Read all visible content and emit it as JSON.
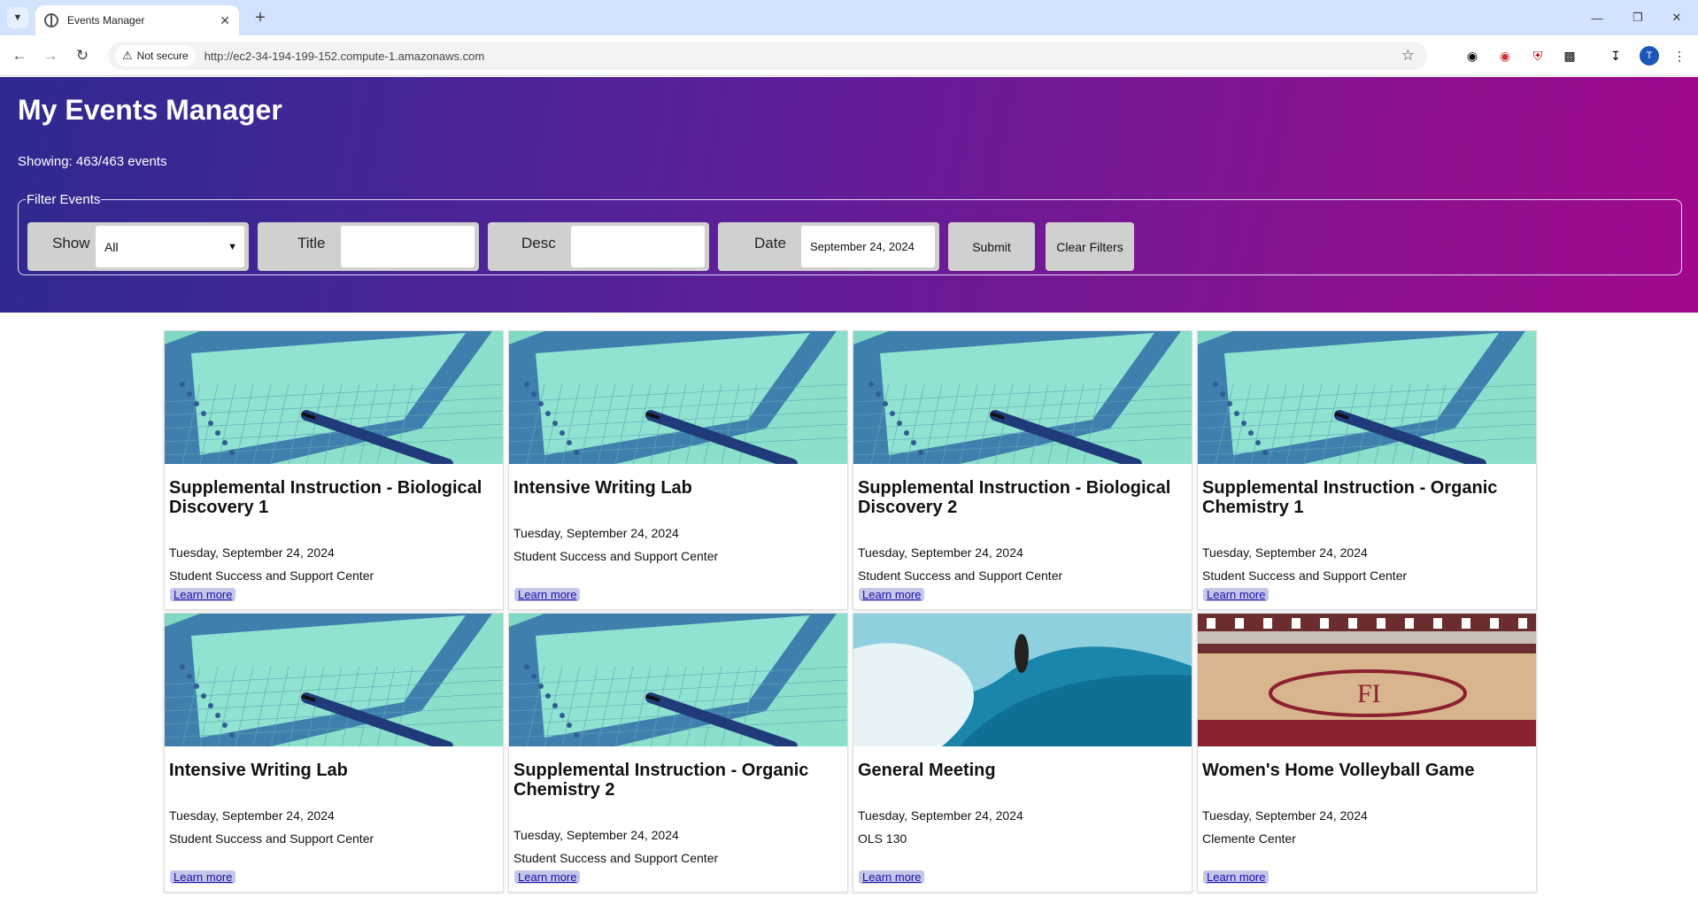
{
  "browser": {
    "tab_title": "Events Manager",
    "not_secure": "Not secure",
    "url": "http://ec2-34-194-199-152.compute-1.amazonaws.com",
    "avatar_initial": "T"
  },
  "header": {
    "title": "My Events Manager",
    "showing": "Showing: 463/463 events"
  },
  "filters": {
    "legend": "Filter Events",
    "show_label": "Show",
    "show_value": "All",
    "title_label": "Title",
    "title_value": "",
    "desc_label": "Desc",
    "desc_value": "",
    "date_label": "Date",
    "date_value": "September 24, 2024",
    "submit_label": "Submit",
    "clear_label": "Clear Filters"
  },
  "events": [
    {
      "title": "Supplemental Instruction - Biological Discovery 1",
      "date": "Tuesday, September 24, 2024",
      "location": "Student Success and Support Center",
      "link": "Learn more",
      "image": "notebook"
    },
    {
      "title": "Intensive Writing Lab",
      "date": "Tuesday, September 24, 2024",
      "location": "Student Success and Support Center",
      "link": "Learn more",
      "image": "notebook"
    },
    {
      "title": "Supplemental Instruction - Biological Discovery 2",
      "date": "Tuesday, September 24, 2024",
      "location": "Student Success and Support Center",
      "link": "Learn more",
      "image": "notebook"
    },
    {
      "title": "Supplemental Instruction - Organic Chemistry 1",
      "date": "Tuesday, September 24, 2024",
      "location": "Student Success and Support Center",
      "link": "Learn more",
      "image": "notebook"
    },
    {
      "title": "Intensive Writing Lab",
      "date": "Tuesday, September 24, 2024",
      "location": "Student Success and Support Center",
      "link": "Learn more",
      "image": "notebook"
    },
    {
      "title": "Supplemental Instruction - Organic Chemistry 2",
      "date": "Tuesday, September 24, 2024",
      "location": "Student Success and Support Center",
      "link": "Learn more",
      "image": "notebook"
    },
    {
      "title": "General Meeting",
      "date": "Tuesday, September 24, 2024",
      "location": "OLS 130",
      "link": "Learn more",
      "image": "surf"
    },
    {
      "title": "Women's Home Volleyball Game",
      "date": "Tuesday, September 24, 2024",
      "location": "Clemente Center",
      "link": "Learn more",
      "image": "court"
    }
  ]
}
